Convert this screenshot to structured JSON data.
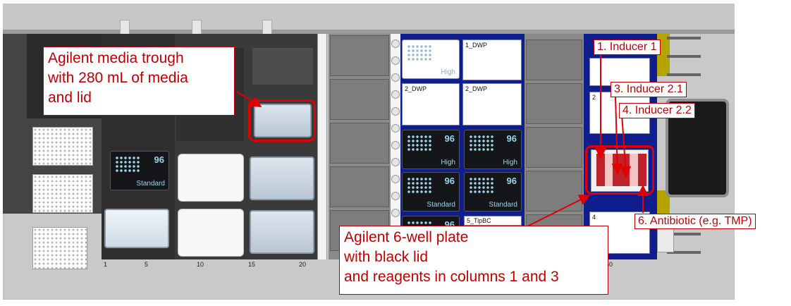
{
  "callouts": {
    "trough": [
      "Agilent media trough",
      "with 280 mL of media",
      "and lid"
    ],
    "six_well": [
      "Agilent 6-well plate",
      "with black lid",
      "and reagents in columns 1 and 3"
    ],
    "inducer1": "1. Inducer 1",
    "inducer21": "3. Inducer 2.1",
    "inducer22": "4. Inducer 2.2",
    "antibiotic": "6. Antibiotic (e.g. TMP)"
  },
  "tipboxes": {
    "count": "96",
    "high": "High",
    "standard": "Standard"
  },
  "positions": {
    "p1": "1_DWP",
    "p2a": "2_DWP",
    "p2b": "2_DWP",
    "p5": "5_TipBC",
    "right2": "2",
    "right4": "4"
  },
  "axis": {
    "t1": "1",
    "t5": "5",
    "t10": "10",
    "t15": "15",
    "t20": "20",
    "t50": "50"
  },
  "colors": {
    "annotation": "#c00000",
    "carrier_blue": "#101d8c",
    "tip_accent": "#9ad5e6"
  }
}
